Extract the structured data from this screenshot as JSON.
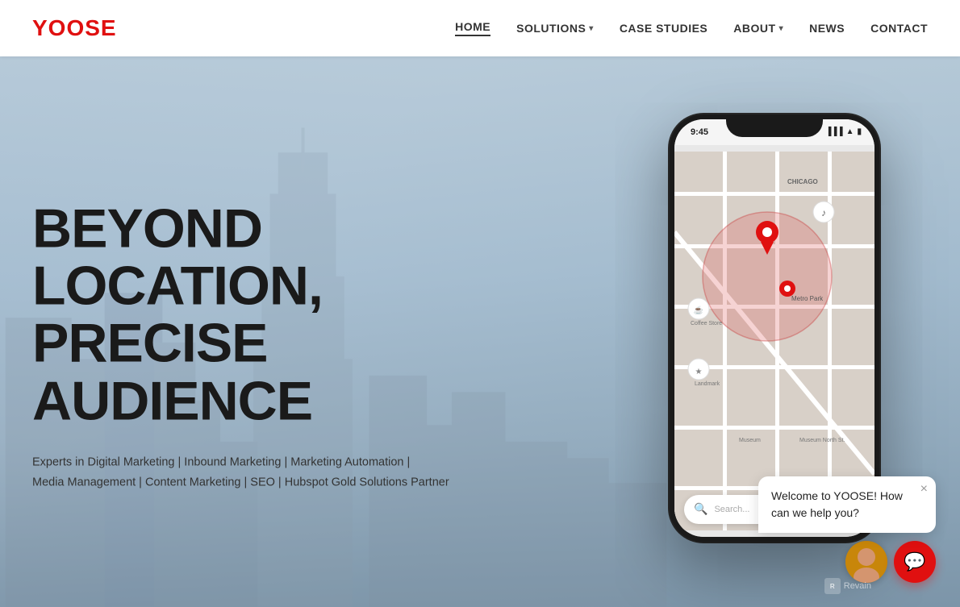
{
  "brand": {
    "logo": "YOOSE"
  },
  "nav": {
    "links": [
      {
        "id": "home",
        "label": "HOME",
        "active": true,
        "hasDropdown": false
      },
      {
        "id": "solutions",
        "label": "SOLUTIONS",
        "active": false,
        "hasDropdown": true
      },
      {
        "id": "case-studies",
        "label": "CASE STUDIES",
        "active": false,
        "hasDropdown": false
      },
      {
        "id": "about",
        "label": "ABOUT",
        "active": false,
        "hasDropdown": true
      },
      {
        "id": "news",
        "label": "NEWS",
        "active": false,
        "hasDropdown": false
      },
      {
        "id": "contact",
        "label": "CONTACT",
        "active": false,
        "hasDropdown": false
      }
    ]
  },
  "hero": {
    "title_line1": "BEYOND LOCATION,",
    "title_line2": "PRECISE AUDIENCE",
    "subtitle": "Experts in Digital Marketing | Inbound Marketing | Marketing Automation |\nMedia Management | Content Marketing | SEO | Hubspot Gold Solutions Partner"
  },
  "phone": {
    "time": "9:45",
    "map_label": "Metro Park",
    "search_placeholder": "Search..."
  },
  "chat": {
    "message": "Welcome to YOOSE! How can we help you?",
    "close_label": "×"
  },
  "revain": {
    "label": "Revain"
  },
  "colors": {
    "brand_red": "#e01010",
    "nav_text": "#333333",
    "hero_bg_start": "#c8d8e8",
    "hero_bg_end": "#a0b8c8"
  }
}
